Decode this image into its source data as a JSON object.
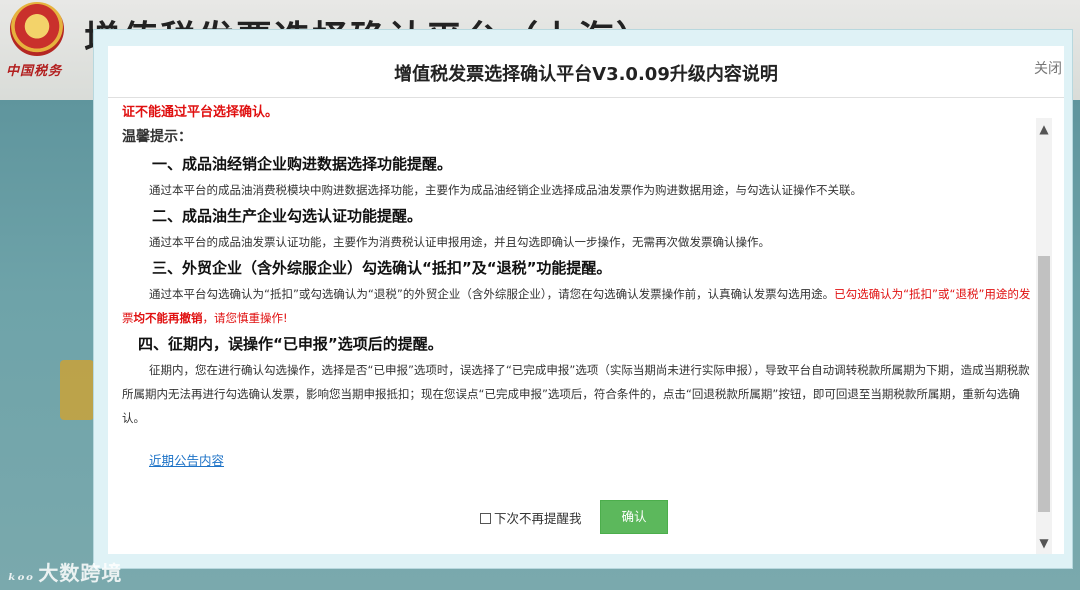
{
  "background": {
    "brand": "中国税务",
    "title": "增值税发票选择确认平台（上海）"
  },
  "modal": {
    "title": "增值税发票选择确认平台V3.0.09升级内容说明",
    "close_label": "关闭",
    "intro_red": "证不能通过平台选择确认。",
    "tip_label": "温馨提示：",
    "sections": [
      {
        "heading": "一、成品油经销企业购进数据选择功能提醒。",
        "body": "通过本平台的成品油消费税模块中购进数据选择功能，主要作为成品油经销企业选择成品油发票作为购进数据用途，与勾选认证操作不关联。"
      },
      {
        "heading": "二、成品油生产企业勾选认证功能提醒。",
        "body": "通过本平台的成品油发票认证功能，主要作为消费税认证申报用途，并且勾选即确认一步操作，无需再次做发票确认操作。"
      },
      {
        "heading": "三、外贸企业（含外综服企业）勾选确认“抵扣”及“退税”功能提醒。",
        "body": "通过本平台勾选确认为“抵扣”或勾选确认为“退税”的外贸企业（含外综服企业），请您在勾选确认发票操作前，认真确认发票勾选用途。",
        "body_red_1": "已勾选确认为“抵扣”或“退税”用途的发票",
        "body_red_bold": "均不能再撤销",
        "body_red_2": "，请您慎重操作!"
      },
      {
        "heading": "四、征期内，误操作“已申报”选项后的提醒。",
        "body": "征期内，您在进行确认勾选操作，选择是否“已申报”选项时，误选择了“已完成申报”选项（实际当期尚未进行实际申报），导致平台自动调转税款所属期为下期，造成当期税款所属期内无法再进行勾选确认发票，影响您当期申报抵扣；现在您误点“已完成申报”选项后，符合条件的，点击“回退税款所属期”按钮，即可回退至当期税款所属期，重新勾选确认。"
      }
    ],
    "link_label": "近期公告内容",
    "checkbox_label": "下次不再提醒我",
    "confirm_label": "确认"
  },
  "watermark": "大数跨境",
  "watermark_logo": "ₖₒₒ"
}
